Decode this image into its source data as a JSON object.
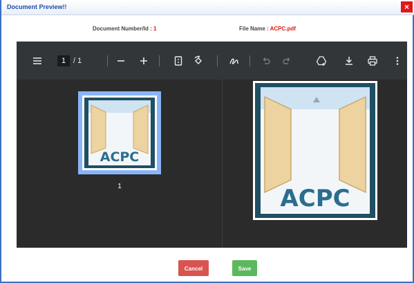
{
  "dialog": {
    "title": "Document Preview!!",
    "close_label": "×"
  },
  "meta": {
    "doc_number_label": "Document Number/Id : ",
    "doc_number_value": "1",
    "file_name_label": "File Name : ",
    "file_name_value": "ACPC.pdf"
  },
  "viewer": {
    "current_page": "1",
    "page_total": "/ 1",
    "thumbnail_number": "1",
    "toolbar_icons": [
      "menu-icon",
      "zoom-out-icon",
      "zoom-in-icon",
      "fit-page-icon",
      "rotate-icon",
      "annotate-icon",
      "undo-icon",
      "redo-icon",
      "add-drive-icon",
      "download-icon",
      "print-icon",
      "more-icon"
    ]
  },
  "logo": {
    "text": "ACPC"
  },
  "footer": {
    "cancel_label": "Cancel",
    "save_label": "Save"
  },
  "colors": {
    "title_blue": "#1e4fa8",
    "accent_red": "#e01818",
    "cancel": "#d9534f",
    "save": "#5cb85c",
    "viewer_bg": "#2b2b2b",
    "toolbar_bg": "#323639",
    "thumb_highlight": "#8ab4f8"
  }
}
